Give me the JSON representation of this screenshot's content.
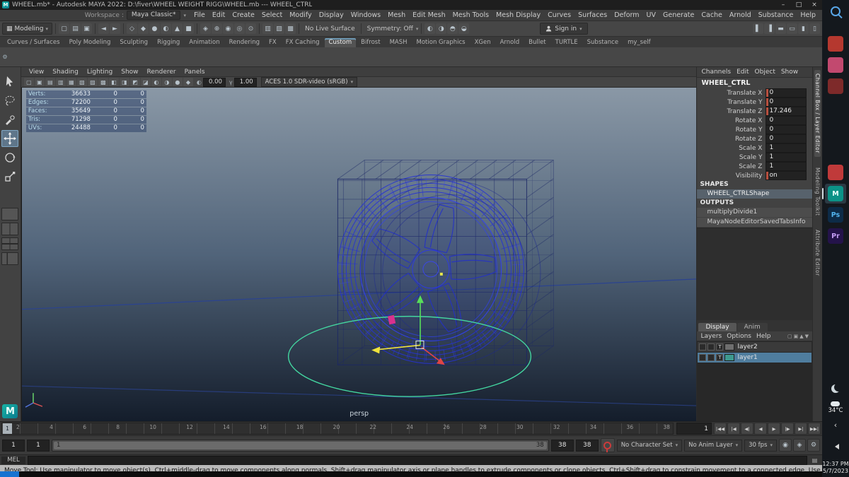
{
  "window": {
    "title": "WHEEL.mb* - Autodesk MAYA 2022: D:\\fiver\\WHEEL WEIGHT RIGG\\WHEEL.mb  ---  WHEEL_CTRL",
    "app_initial": "M",
    "controls": {
      "minimize": "–",
      "maximize": "□",
      "close": "×"
    }
  },
  "menubar": {
    "items": [
      "File",
      "Edit",
      "Create",
      "Select",
      "Modify",
      "Display",
      "Windows",
      "Mesh",
      "Edit Mesh",
      "Mesh Tools",
      "Mesh Display",
      "Curves",
      "Surfaces",
      "Deform",
      "UV",
      "Generate",
      "Cache",
      "Arnold",
      "Substance",
      "Help"
    ],
    "workspace_label": "Workspace :",
    "workspace_value": "Maya Classic*",
    "caret": "▾"
  },
  "statusline": {
    "grid_glyph": "▦",
    "mode": "Modeling",
    "caret": "▾",
    "file_icons": [
      {
        "name": "new-scene-button",
        "glyph": "▢"
      },
      {
        "name": "open-scene-button",
        "glyph": "▤"
      },
      {
        "name": "save-scene-button",
        "glyph": "▣"
      }
    ],
    "undo_icons": [
      {
        "name": "undo-button",
        "glyph": "◄"
      },
      {
        "name": "redo-button",
        "glyph": "►"
      }
    ],
    "selection_icons": [
      {
        "name": "select-by-hierarchy-button",
        "glyph": "◇"
      },
      {
        "name": "select-by-object-button",
        "glyph": "◆"
      },
      {
        "name": "select-by-component-button",
        "glyph": "●"
      },
      {
        "name": "selection-mask-button",
        "glyph": "◐"
      },
      {
        "name": "highlight-selection-button",
        "glyph": "▲"
      },
      {
        "name": "lock-selection-button",
        "glyph": "■"
      }
    ],
    "snap_icons": [
      {
        "name": "snap-to-grid-button",
        "glyph": "◈"
      },
      {
        "name": "snap-to-curve-button",
        "glyph": "⊕"
      },
      {
        "name": "snap-to-point-button",
        "glyph": "◉"
      },
      {
        "name": "snap-to-projected-center-button",
        "glyph": "◎"
      },
      {
        "name": "snap-to-view-plane-button",
        "glyph": "⊙"
      }
    ],
    "history_icons": [
      {
        "name": "construction-history-button",
        "glyph": "▥"
      },
      {
        "name": "list-inputs-button",
        "glyph": "▨"
      },
      {
        "name": "list-outputs-button",
        "glyph": "▩"
      }
    ],
    "no_live_surface": "No Live Surface",
    "symmetry": "Symmetry: Off",
    "render_icons": [
      {
        "name": "render-current-frame-button",
        "glyph": "◐"
      },
      {
        "name": "ipr-render-button",
        "glyph": "◑"
      },
      {
        "name": "render-settings-button",
        "glyph": "◓"
      },
      {
        "name": "display-render-settings-button",
        "glyph": "◒"
      }
    ],
    "sign_in": "Sign in",
    "panel_toggle_icons": [
      {
        "name": "toggle-outliner-button",
        "glyph": "▌"
      },
      {
        "name": "toggle-tool-settings-button",
        "glyph": "▐"
      },
      {
        "name": "toggle-attribute-editor-button",
        "glyph": "▬"
      },
      {
        "name": "toggle-modeling-toolkit-button",
        "glyph": "▭"
      },
      {
        "name": "toggle-channel-box-button",
        "glyph": "▮"
      },
      {
        "name": "toggle-shelf-button",
        "glyph": "▯"
      }
    ]
  },
  "shelf": {
    "tabs": [
      {
        "label": "Curves / Surfaces"
      },
      {
        "label": "Poly Modeling"
      },
      {
        "label": "Sculpting"
      },
      {
        "label": "Rigging"
      },
      {
        "label": "Animation"
      },
      {
        "label": "Rendering"
      },
      {
        "label": "FX"
      },
      {
        "label": "FX Caching"
      },
      {
        "label": "Custom",
        "class": "active"
      },
      {
        "label": "Bifrost"
      },
      {
        "label": "MASH"
      },
      {
        "label": "Motion Graphics"
      },
      {
        "label": "XGen"
      },
      {
        "label": "Arnold"
      },
      {
        "label": "Bullet"
      },
      {
        "label": "TURTLE"
      },
      {
        "label": "Substance"
      },
      {
        "label": "my_self"
      }
    ],
    "gear_glyph": "⚙"
  },
  "panel_menu": {
    "items": [
      "View",
      "Shading",
      "Lighting",
      "Show",
      "Renderer",
      "Panels"
    ]
  },
  "viewport_toolbar": {
    "icons": [
      {
        "name": "select-camera-icon",
        "glyph": "▢"
      },
      {
        "name": "lock-camera-icon",
        "glyph": "▣"
      },
      {
        "name": "camera-attributes-icon",
        "glyph": "▤"
      },
      {
        "name": "bookmarks-icon",
        "glyph": "▥"
      },
      {
        "name": "image-plane-icon",
        "glyph": "▦"
      },
      {
        "name": "two-d-pan-zoom-icon",
        "glyph": "▧"
      },
      {
        "name": "oversampling-icon",
        "glyph": "▨"
      },
      {
        "name": "film-gate-icon",
        "glyph": "▩"
      },
      {
        "name": "resolution-gate-icon",
        "glyph": "◧"
      },
      {
        "name": "gate-mask-icon",
        "glyph": "◨"
      },
      {
        "name": "field-chart-icon",
        "glyph": "◩"
      },
      {
        "name": "safe-action-icon",
        "glyph": "◪"
      },
      {
        "name": "wireframe-display-icon",
        "glyph": "◐"
      },
      {
        "name": "shaded-display-icon",
        "glyph": "◑"
      },
      {
        "name": "textured-display-icon",
        "glyph": "●"
      },
      {
        "name": "lighting-display-icon",
        "glyph": "◆"
      }
    ],
    "exposure_icon": "◐",
    "exposure": "0.00",
    "gamma_icon": "γ",
    "gamma": "1.00",
    "colorspace": "ACES 1.0 SDR-video (sRGB)",
    "caret": "▾"
  },
  "hud": {
    "rows": [
      {
        "label": "Verts:",
        "v1": "36633",
        "v2": "0",
        "v3": "0"
      },
      {
        "label": "Edges:",
        "v1": "72200",
        "v2": "0",
        "v3": "0"
      },
      {
        "label": "Faces:",
        "v1": "35649",
        "v2": "0",
        "v3": "0"
      },
      {
        "label": "Tris:",
        "v1": "71298",
        "v2": "0",
        "v3": "0"
      },
      {
        "label": "UVs:",
        "v1": "24488",
        "v2": "0",
        "v3": "0"
      }
    ]
  },
  "viewport": {
    "camera_label": "persp"
  },
  "channel_box": {
    "menu": [
      "Channels",
      "Edit",
      "Object",
      "Show"
    ],
    "node": "WHEEL_CTRL",
    "channels": [
      {
        "label": "Translate X",
        "value": "0",
        "class": "keyed"
      },
      {
        "label": "Translate Y",
        "value": "0",
        "class": "keyed"
      },
      {
        "label": "Translate Z",
        "value": "17.246",
        "class": "keyed"
      },
      {
        "label": "Rotate X",
        "value": "0"
      },
      {
        "label": "Rotate Y",
        "value": "0"
      },
      {
        "label": "Rotate Z",
        "value": "0"
      },
      {
        "label": "Scale X",
        "value": "1"
      },
      {
        "label": "Scale Y",
        "value": "1"
      },
      {
        "label": "Scale Z",
        "value": "1"
      },
      {
        "label": "Visibility",
        "value": "on",
        "class": "keyed"
      }
    ],
    "shapes_header": "SHAPES",
    "shape_name": "WHEEL_CTRLShape",
    "outputs_header": "OUTPUTS",
    "outputs": [
      "multiplyDivide1",
      "MayaNodeEditorSavedTabsInfo"
    ]
  },
  "layer_editor": {
    "tabs": [
      {
        "label": "Display",
        "class": "active"
      },
      {
        "label": "Anim"
      }
    ],
    "menu": [
      "Layers",
      "Options",
      "Help"
    ],
    "toolbar_icons": [
      {
        "name": "layer-new-empty-icon",
        "glyph": "▢"
      },
      {
        "name": "layer-new-from-selected-icon",
        "glyph": "▣"
      },
      {
        "name": "layer-move-up-icon",
        "glyph": "▲"
      },
      {
        "name": "layer-move-down-icon",
        "glyph": "▼"
      }
    ],
    "t_label": "T",
    "layers": [
      {
        "name": "layer2",
        "swatch": "#6e6e6e"
      },
      {
        "name": "layer1",
        "class": "selected",
        "swatch": "#3e9a8f"
      }
    ]
  },
  "side_tabs": {
    "items": [
      {
        "label": "Channel Box / Layer Editor",
        "class": "active"
      },
      {
        "label": "Modeling Toolkit"
      },
      {
        "label": "Attribute Editor"
      }
    ]
  },
  "time_slider": {
    "labels": [
      "2",
      "4",
      "6",
      "8",
      "10",
      "12",
      "14",
      "16",
      "18",
      "20",
      "22",
      "24",
      "26",
      "28",
      "30",
      "32",
      "34",
      "36",
      "38"
    ],
    "current_frame": "1",
    "current_time": "1",
    "transport": [
      {
        "name": "go-to-start-button",
        "glyph": "|◀◀"
      },
      {
        "name": "step-back-frame-button",
        "glyph": "|◀"
      },
      {
        "name": "step-back-key-button",
        "glyph": "◀|"
      },
      {
        "name": "play-backwards-button",
        "glyph": "◀"
      },
      {
        "name": "play-forwards-button",
        "glyph": "▶"
      },
      {
        "name": "step-forward-key-button",
        "glyph": "|▶"
      },
      {
        "name": "step-forward-frame-button",
        "glyph": "▶|"
      },
      {
        "name": "go-to-end-button",
        "glyph": "▶▶|"
      }
    ]
  },
  "range_slider": {
    "anim_start": "1",
    "playback_start": "1",
    "range_start": "1",
    "range_end": "38",
    "playback_end": "38",
    "anim_end": "38",
    "character_set": "No Character Set",
    "anim_layer": "No Anim Layer",
    "fps": "30 fps",
    "caret": "▾",
    "trailing_icons": [
      {
        "name": "sound-toggle-button",
        "glyph": "◉"
      },
      {
        "name": "loop-mode-button",
        "glyph": "◈"
      },
      {
        "name": "animation-preferences-button",
        "glyph": "⚙"
      }
    ]
  },
  "command_line": {
    "label": "MEL",
    "script_editor_glyph": "▤"
  },
  "help_line": {
    "text": "Move Tool: Use manipulator to move object(s). Ctrl+middle-drag to move components along normals. Shift+drag manipulator axis or plane handles to extrude components or clone objects. Ctrl+Shift+drag to constrain movement to a connected edge. Use D or INSERT to change the pivot position and axis orientation."
  },
  "taskbar": {
    "apps_top": [
      {
        "name": "app-icon-red",
        "bg": "#b5382f",
        "fg": "#ffffff",
        "label": ""
      },
      {
        "name": "app-icon-pink",
        "bg": "#c2496f",
        "fg": "#ffffff",
        "label": ""
      },
      {
        "name": "app-icon-darkred",
        "bg": "#7e2a2a",
        "fg": "#ffffff",
        "label": ""
      }
    ],
    "apps_mid": [
      {
        "name": "app-icon-crimson",
        "bg": "#c03a3a",
        "fg": "#ffffff",
        "label": ""
      },
      {
        "name": "maya-taskbar-icon",
        "bg": "#0c9287",
        "fg": "#eafffb",
        "label": "M",
        "class": "active"
      },
      {
        "name": "photoshop-taskbar-icon",
        "bg": "#0d2b47",
        "fg": "#53b5f0",
        "label": "Ps"
      },
      {
        "name": "premiere-taskbar-icon",
        "bg": "#24134a",
        "fg": "#c49df5",
        "label": "Pr"
      }
    ],
    "temperature": "34°C",
    "chevron": "‹",
    "clock_time": "12:37 PM",
    "clock_date": "5/7/2023"
  }
}
